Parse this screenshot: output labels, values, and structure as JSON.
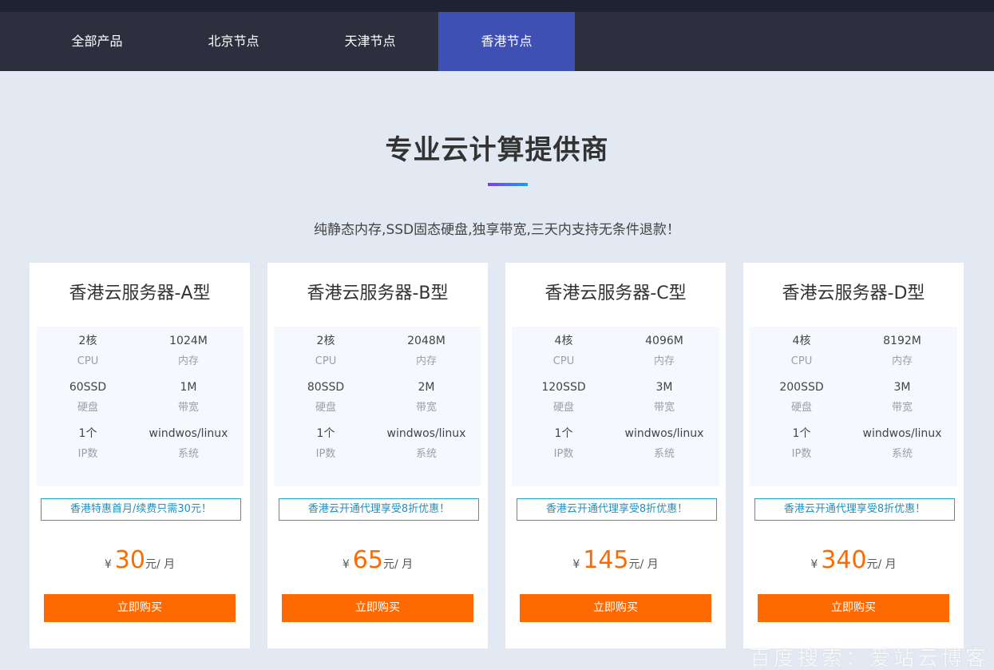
{
  "nav": {
    "tabs": [
      {
        "label": "全部产品"
      },
      {
        "label": "北京节点"
      },
      {
        "label": "天津节点"
      },
      {
        "label": "香港节点"
      }
    ]
  },
  "hero": {
    "title": "专业云计算提供商",
    "subtitle": "纯静态内存,SSD固态硬盘,独享带宽,三天内支持无条件退款！"
  },
  "labels": {
    "cpu": "CPU",
    "mem": "内存",
    "disk": "硬盘",
    "bw": "带宽",
    "ip": "IP数",
    "os": "系统",
    "yen": "¥",
    "unit": "元/ 月",
    "buy": "立即购买"
  },
  "plans": [
    {
      "name": "香港云服务器-A型",
      "cpu": "2核",
      "mem": "1024M",
      "disk": "60SSD",
      "bw": "1M",
      "ip": "1个",
      "os": "windwos/linux",
      "promo": "香港特惠首月/续费只需30元！",
      "price": "30"
    },
    {
      "name": "香港云服务器-B型",
      "cpu": "2核",
      "mem": "2048M",
      "disk": "80SSD",
      "bw": "2M",
      "ip": "1个",
      "os": "windwos/linux",
      "promo": "香港云开通代理享受8折优惠！",
      "price": "65"
    },
    {
      "name": "香港云服务器-C型",
      "cpu": "4核",
      "mem": "4096M",
      "disk": "120SSD",
      "bw": "3M",
      "ip": "1个",
      "os": "windwos/linux",
      "promo": "香港云开通代理享受8折优惠！",
      "price": "145"
    },
    {
      "name": "香港云服务器-D型",
      "cpu": "4核",
      "mem": "8192M",
      "disk": "200SSD",
      "bw": "3M",
      "ip": "1个",
      "os": "windwos/linux",
      "promo": "香港云开通代理享受8折优惠！",
      "price": "340"
    }
  ],
  "watermark": "百度搜索：爱站云博客",
  "colors": {
    "nav_bg": "#2d2f3e",
    "nav_active": "#3f50b5",
    "accent": "#ff6a00",
    "promo": "#1e90c0"
  }
}
